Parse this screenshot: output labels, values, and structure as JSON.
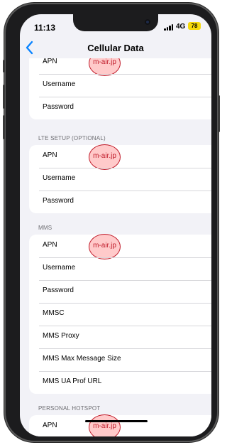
{
  "status_bar": {
    "time": "11:13",
    "network": "4G",
    "battery": "78"
  },
  "nav": {
    "title": "Cellular Data",
    "back_icon": "chevron-left-icon"
  },
  "annotation": {
    "value": "m-air.jp",
    "color": "#c01b2a"
  },
  "sections": [
    {
      "header": "",
      "rows": [
        "APN",
        "Username",
        "Password"
      ],
      "marked_row": 0
    },
    {
      "header": "LTE SETUP (OPTIONAL)",
      "rows": [
        "APN",
        "Username",
        "Password"
      ],
      "marked_row": 0
    },
    {
      "header": "MMS",
      "rows": [
        "APN",
        "Username",
        "Password",
        "MMSC",
        "MMS Proxy",
        "MMS Max Message Size",
        "MMS UA Prof URL"
      ],
      "marked_row": 0
    },
    {
      "header": "PERSONAL HOTSPOT",
      "rows": [
        "APN"
      ],
      "marked_row": 0
    }
  ]
}
